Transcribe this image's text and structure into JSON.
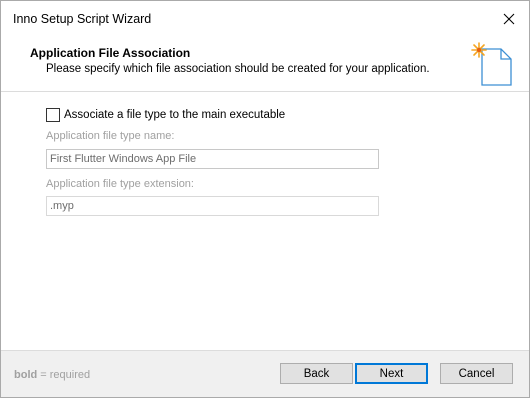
{
  "window": {
    "title": "Inno Setup Script Wizard"
  },
  "header": {
    "title": "Application File Association",
    "subtitle": "Please specify which file association should be created for your application."
  },
  "form": {
    "associate_checkbox": {
      "label": "Associate a file type to the main executable",
      "checked": false
    },
    "file_type_name": {
      "label": "Application file type name:",
      "value": "First Flutter Windows App File"
    },
    "file_type_extension": {
      "label": "Application file type extension:",
      "value": ".myp"
    }
  },
  "footer": {
    "hint_bold": "bold",
    "hint_rest": " = required",
    "back_label": "Back",
    "next_label": "Next",
    "cancel_label": "Cancel"
  },
  "icons": {
    "close": "close-icon",
    "wizard": "wizard-document-star-icon"
  },
  "colors": {
    "accent": "#0078d7",
    "star": "#f5a623",
    "disabled_text": "#a0a0a0"
  }
}
